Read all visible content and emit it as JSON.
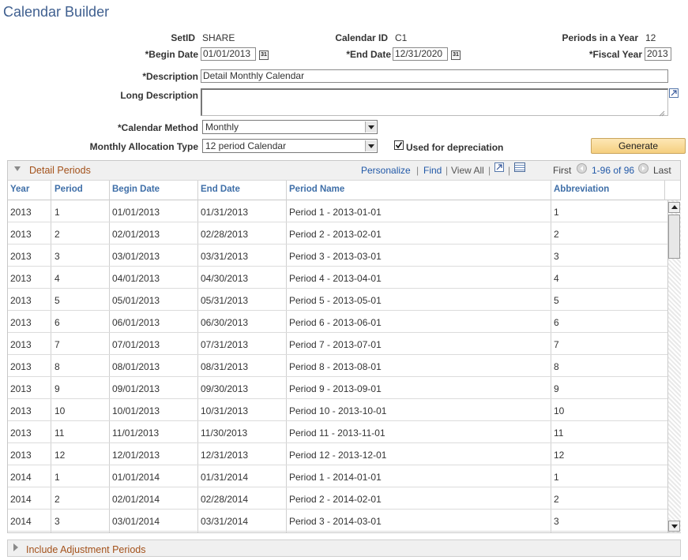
{
  "page": {
    "title": "Calendar Builder"
  },
  "form": {
    "setid_label": "SetID",
    "setid_value": "SHARE",
    "calendar_id_label": "Calendar ID",
    "calendar_id_value": "C1",
    "periods_label": "Periods in a Year",
    "periods_value": "12",
    "begin_date_label": "*Begin Date",
    "begin_date_value": "01/01/2013",
    "end_date_label": "*End Date",
    "end_date_value": "12/31/2020",
    "fiscal_year_label": "*Fiscal Year",
    "fiscal_year_value": "2013",
    "description_label": "*Description",
    "description_value": "Detail Monthly Calendar",
    "long_description_label": "Long Description",
    "long_description_value": "",
    "calendar_method_label": "*Calendar Method",
    "calendar_method_value": "Monthly",
    "allocation_type_label": "Monthly Allocation Type",
    "allocation_type_value": "12 period Calendar",
    "depreciation_label": "Used for depreciation",
    "depreciation_checked": true,
    "generate_label": "Generate",
    "calendar_icon_text": "31"
  },
  "grid": {
    "title": "Detail Periods",
    "personalize": "Personalize",
    "find": "Find",
    "view_all": "View All",
    "first": "First",
    "range": "1-96 of 96",
    "last": "Last",
    "columns": [
      "Year",
      "Period",
      "Begin Date",
      "End Date",
      "Period Name",
      "Abbreviation"
    ],
    "rows": [
      [
        "2013",
        "1",
        "01/01/2013",
        "01/31/2013",
        "Period 1 - 2013-01-01",
        "1"
      ],
      [
        "2013",
        "2",
        "02/01/2013",
        "02/28/2013",
        "Period 2 - 2013-02-01",
        "2"
      ],
      [
        "2013",
        "3",
        "03/01/2013",
        "03/31/2013",
        "Period 3 - 2013-03-01",
        "3"
      ],
      [
        "2013",
        "4",
        "04/01/2013",
        "04/30/2013",
        "Period 4 - 2013-04-01",
        "4"
      ],
      [
        "2013",
        "5",
        "05/01/2013",
        "05/31/2013",
        "Period 5 - 2013-05-01",
        "5"
      ],
      [
        "2013",
        "6",
        "06/01/2013",
        "06/30/2013",
        "Period 6 - 2013-06-01",
        "6"
      ],
      [
        "2013",
        "7",
        "07/01/2013",
        "07/31/2013",
        "Period 7 - 2013-07-01",
        "7"
      ],
      [
        "2013",
        "8",
        "08/01/2013",
        "08/31/2013",
        "Period 8 - 2013-08-01",
        "8"
      ],
      [
        "2013",
        "9",
        "09/01/2013",
        "09/30/2013",
        "Period 9 - 2013-09-01",
        "9"
      ],
      [
        "2013",
        "10",
        "10/01/2013",
        "10/31/2013",
        "Period 10 - 2013-10-01",
        "10"
      ],
      [
        "2013",
        "11",
        "11/01/2013",
        "11/30/2013",
        "Period 11 - 2013-11-01",
        "11"
      ],
      [
        "2013",
        "12",
        "12/01/2013",
        "12/31/2013",
        "Period 12 - 2013-12-01",
        "12"
      ],
      [
        "2014",
        "1",
        "01/01/2014",
        "01/31/2014",
        "Period 1 - 2014-01-01",
        "1"
      ],
      [
        "2014",
        "2",
        "02/01/2014",
        "02/28/2014",
        "Period 2 - 2014-02-01",
        "2"
      ],
      [
        "2014",
        "3",
        "03/01/2014",
        "03/31/2014",
        "Period 3 - 2014-03-01",
        "3"
      ]
    ]
  },
  "footer": {
    "title": "Include Adjustment Periods"
  }
}
